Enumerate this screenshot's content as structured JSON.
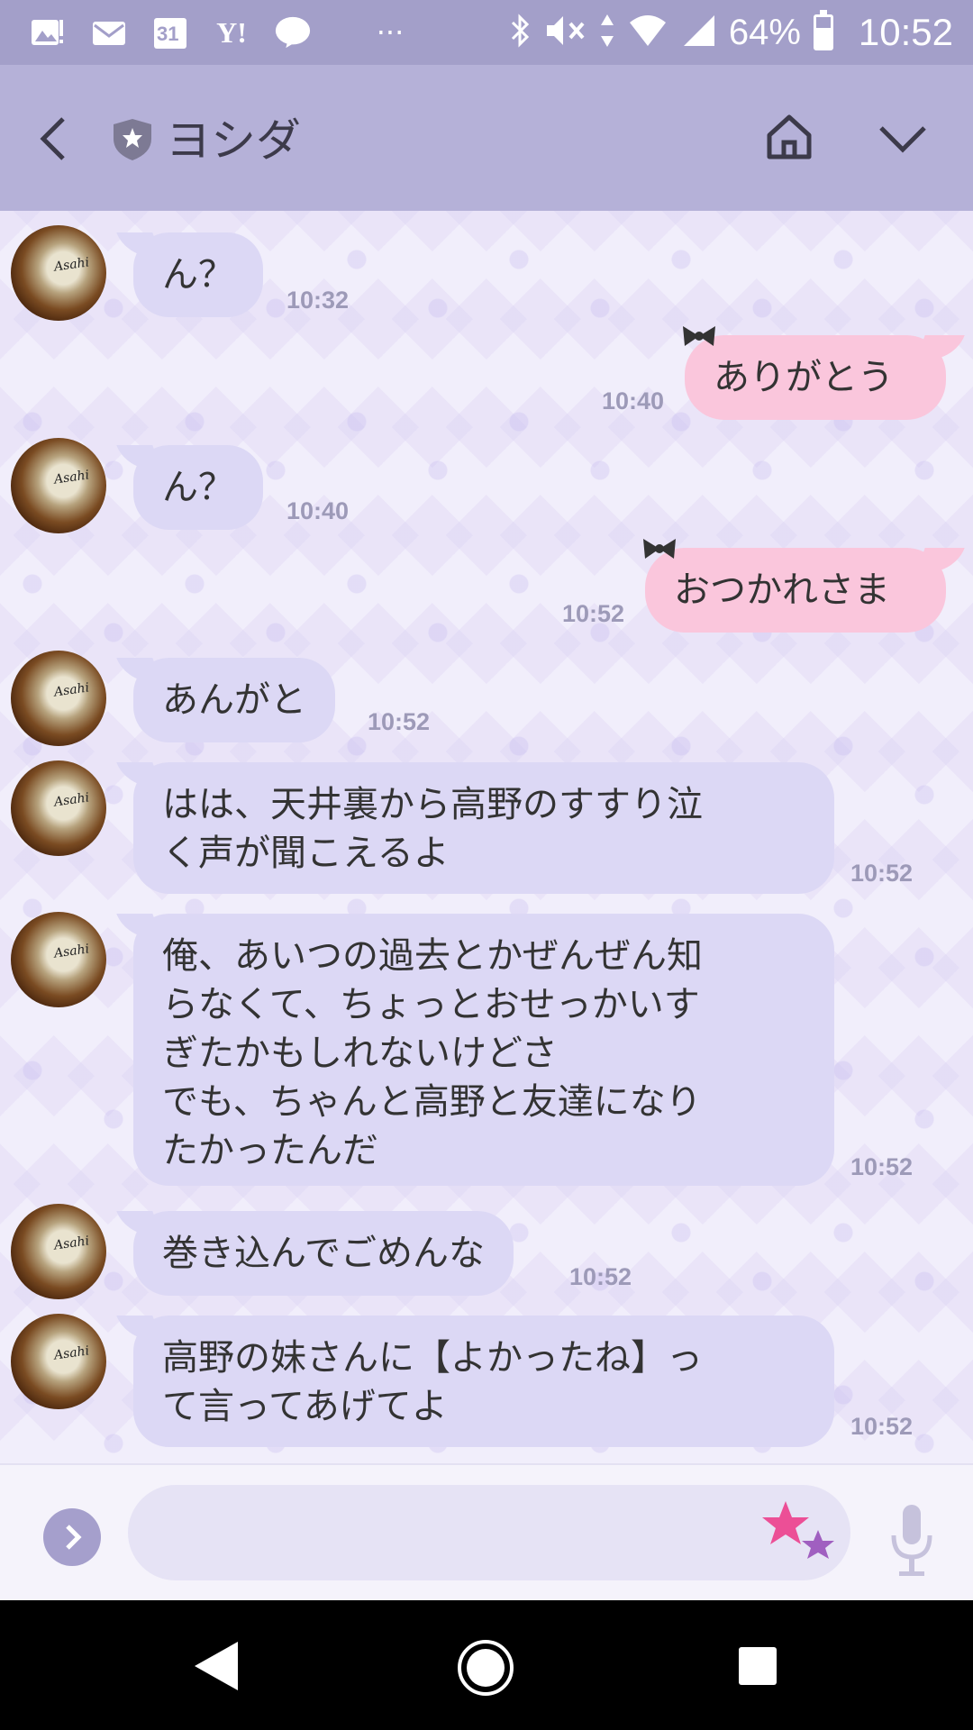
{
  "status_bar": {
    "icons": [
      "gallery-notification-icon",
      "mail-icon",
      "calendar-icon",
      "yahoo-icon",
      "line-icon",
      "more-icon",
      "bluetooth-icon",
      "mute-icon",
      "data-arrows-icon",
      "wifi-icon",
      "signal-icon"
    ],
    "calendar_day": "31",
    "yahoo_text": "Y!",
    "line_text": "LINE",
    "more": "···",
    "battery_percent": "64%",
    "battery_level": 0.64,
    "clock": "10:52"
  },
  "header": {
    "title": "ヨシダ",
    "back_icon": "chevron-left-icon",
    "badge_icon": "shield-star-icon",
    "home_icon": "home-icon",
    "menu_icon": "chevron-down-icon"
  },
  "messages": [
    {
      "side": "in",
      "text": "ん？",
      "time": "10:32"
    },
    {
      "side": "out",
      "text": "ありがとう",
      "time": "10:40"
    },
    {
      "side": "in",
      "text": "ん？",
      "time": "10:40"
    },
    {
      "side": "out",
      "text": "おつかれさま",
      "time": "10:52"
    },
    {
      "side": "in",
      "text": "あんがと",
      "time": "10:52"
    },
    {
      "side": "in",
      "text": "はは、天井裏から高野のすすり泣\nく声が聞こえるよ",
      "time": "10:52"
    },
    {
      "side": "in",
      "text": "俺、あいつの過去とかぜんぜん知\nらなくて、ちょっとおせっかいす\nぎたかもしれないけどさ\nでも、ちゃんと高野と友達になり\nたかったんだ",
      "time": "10:52"
    },
    {
      "side": "in",
      "text": "巻き込んでごめんな",
      "time": "10:52"
    },
    {
      "side": "in",
      "text": "高野の妹さんに【よかったね】っ\nて言ってあげてよ",
      "time": "10:52"
    }
  ],
  "input_bar": {
    "placeholder": "",
    "expand_icon": "chevron-right-icon",
    "sticker_icon": "star-sticker-icon",
    "mic_icon": "microphone-icon"
  },
  "colors": {
    "status_bar": "#a39fc9",
    "header": "#b5b1d8",
    "incoming_bubble": "#dcd8f5",
    "outgoing_bubble": "#fac6dc",
    "timestamp": "#9d9ab8"
  }
}
